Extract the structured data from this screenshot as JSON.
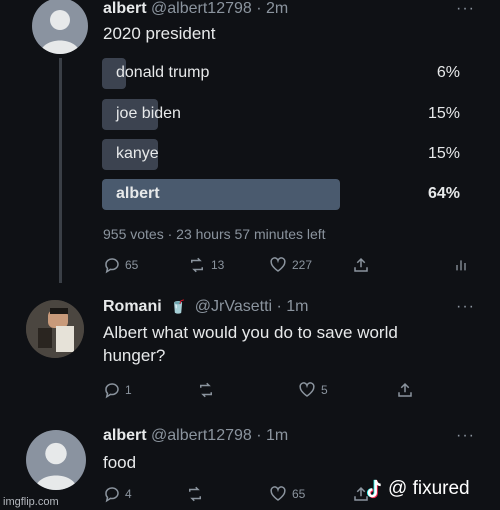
{
  "tweet1": {
    "name": "albert",
    "handle_time": "@albert12798 · 2m",
    "more": "···",
    "text": "2020 president",
    "poll": {
      "options": [
        {
          "label": "donald trump",
          "percent_text": "6%",
          "percent": 6
        },
        {
          "label": "joe biden",
          "percent_text": "15%",
          "percent": 15
        },
        {
          "label": "kanye",
          "percent_text": "15%",
          "percent": 15
        },
        {
          "label": "albert",
          "percent_text": "64%",
          "percent": 64
        }
      ],
      "meta": "955 votes · 23 hours 57 minutes left"
    },
    "actions": {
      "reply": "65",
      "retweet": "13",
      "like": "227"
    }
  },
  "tweet2": {
    "name": "Romani",
    "badge": "🥤",
    "handle_time": "@JrVasetti · 1m",
    "more": "···",
    "text_line1": "Albert what would you do to save world",
    "text_line2": "hunger?",
    "actions": {
      "reply": "1",
      "retweet": "",
      "like": "5"
    }
  },
  "tweet3": {
    "name": "albert",
    "handle_time": "@albert12798 · 1m",
    "more": "···",
    "text": "food",
    "actions": {
      "reply": "4",
      "retweet": "",
      "like": "65"
    }
  },
  "watermarks": {
    "imgflip": "imgflip.com",
    "tiktok_handle": "@ fixured"
  },
  "colors": {
    "background": "#0f1115",
    "poll_bar": "#3c4350",
    "poll_bar_winner": "#4a5a6e",
    "muted_text": "#8b949e"
  }
}
